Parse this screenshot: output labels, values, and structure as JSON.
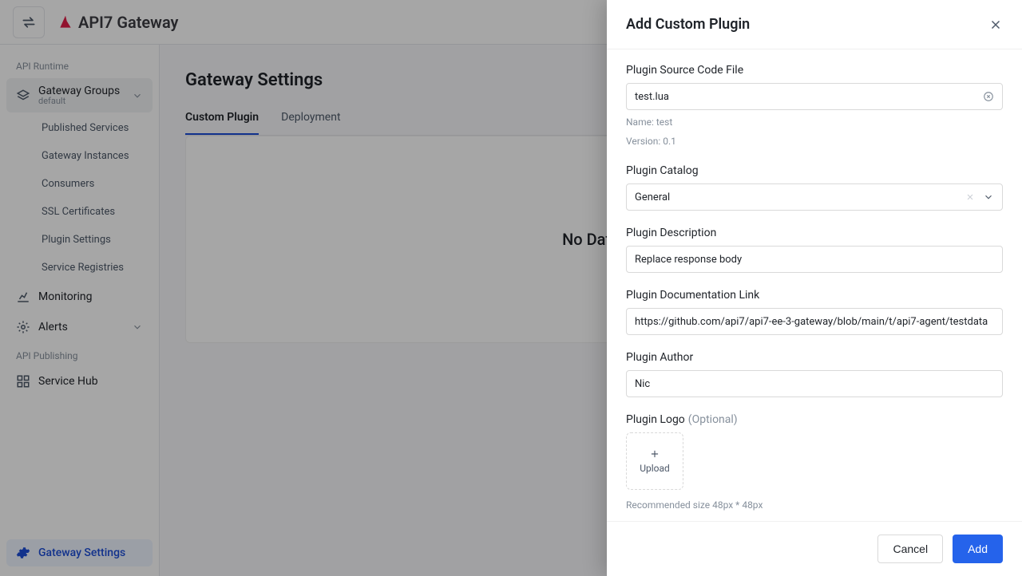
{
  "brand": "API7 Gateway",
  "sidebar": {
    "section_runtime": "API Runtime",
    "gateway_groups": {
      "label": "Gateway Groups",
      "sub": "default"
    },
    "children": [
      {
        "label": "Published Services"
      },
      {
        "label": "Gateway Instances"
      },
      {
        "label": "Consumers"
      },
      {
        "label": "SSL Certificates"
      },
      {
        "label": "Plugin Settings"
      },
      {
        "label": "Service Registries"
      }
    ],
    "monitoring": "Monitoring",
    "alerts": "Alerts",
    "section_publishing": "API Publishing",
    "service_hub": "Service Hub",
    "gateway_settings": "Gateway Settings"
  },
  "page": {
    "title": "Gateway Settings",
    "tabs": {
      "custom_plugin": "Custom Plugin",
      "deployment": "Deployment"
    },
    "empty": "No Data"
  },
  "drawer": {
    "title": "Add Custom Plugin",
    "source_label": "Plugin Source Code File",
    "source_value": "test.lua",
    "source_meta_name": "Name: test",
    "source_meta_version": "Version: 0.1",
    "catalog_label": "Plugin Catalog",
    "catalog_value": "General",
    "desc_label": "Plugin Description",
    "desc_value": "Replace response body",
    "doc_label": "Plugin Documentation Link",
    "doc_value": "https://github.com/api7/api7-ee-3-gateway/blob/main/t/api7-agent/testdata",
    "author_label": "Plugin Author",
    "author_value": "Nic",
    "logo_label": "Plugin Logo",
    "logo_hint": "(Optional)",
    "upload_label": "Upload",
    "logo_note": "Recommended size 48px * 48px",
    "cancel": "Cancel",
    "add": "Add"
  }
}
